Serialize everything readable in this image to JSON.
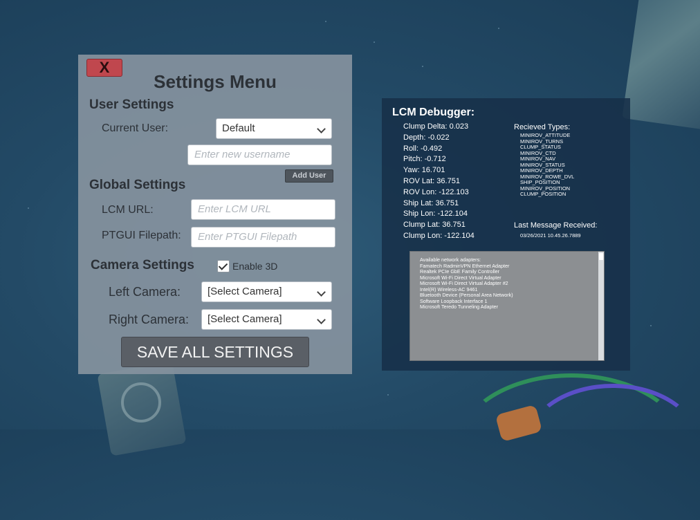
{
  "settings": {
    "close_label": "X",
    "title": "Settings Menu",
    "user_settings_heading": "User Settings",
    "current_user_label": "Current User:",
    "current_user_value": "Default",
    "new_username_placeholder": "Enter new username",
    "add_user_label": "Add User",
    "global_settings_heading": "Global Settings",
    "lcm_url_label": "LCM URL:",
    "lcm_url_placeholder": "Enter LCM URL",
    "ptgui_label": "PTGUI Filepath:",
    "ptgui_placeholder": "Enter PTGUI Filepath",
    "camera_settings_heading": "Camera Settings",
    "enable_3d_label": "Enable 3D",
    "enable_3d_checked": true,
    "left_camera_label": "Left Camera:",
    "left_camera_value": "[Select Camera]",
    "right_camera_label": "Right Camera:",
    "right_camera_value": "[Select Camera]",
    "save_label": "SAVE ALL SETTINGS"
  },
  "debugger": {
    "title": "LCM Debugger:",
    "values": [
      "Clump Delta: 0.023",
      "Depth: -0.022",
      "Roll: -0.492",
      "Pitch: -0.712",
      "Yaw: 16.701",
      "ROV Lat: 36.751",
      "ROV Lon: -122.103",
      "Ship Lat: 36.751",
      "Ship Lon: -122.104",
      "Clump Lat: 36.751",
      "Clump Lon: -122.104"
    ],
    "types_heading": "Recieved Types:",
    "types": [
      "MINIROV_ATTITUDE",
      "MINIROV_TURNS",
      "CLUMP_STATUS",
      "MINIROV_CTD",
      "MINIROV_NAV",
      "MINIROV_STATUS",
      "MINIROV_DEPTH",
      "MINIROV_ROWE_DVL",
      "SHIP_POSITION",
      "MINIROV_POSITION",
      "CLUMP_POSITION"
    ],
    "last_message_heading": "Last Message Received:",
    "last_message_value": "03/26/2021 10.45.26.7889",
    "network_lines": [
      "Available network adapters:",
      "Famatech RadminVPN Ethernet Adapter",
      "Realtek PCIe GbE Family Controller",
      "Microsoft Wi-Fi Direct Virtual Adapter",
      "Microsoft Wi-Fi Direct Virtual Adapter #2",
      "Intel(R) Wireless-AC 9461",
      "Bluetooth Device (Personal Area Network)",
      "Software Loopback Interface 1",
      "Microsoft Teredo Tunneling Adapter"
    ]
  }
}
